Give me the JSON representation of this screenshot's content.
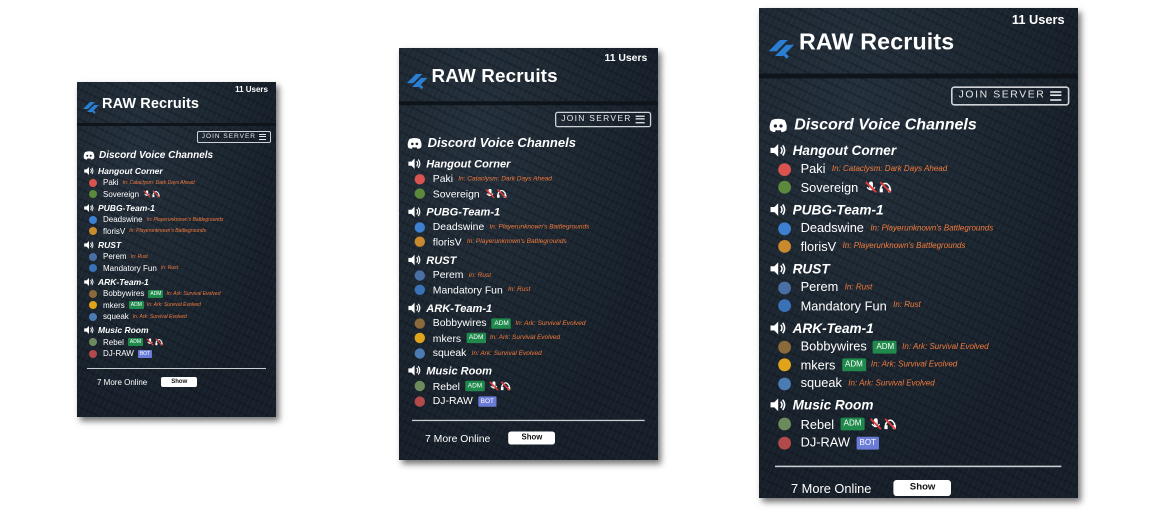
{
  "server": {
    "name": "RAW Recruits",
    "user_count": "11 Users",
    "join_label": "JOIN SERVER",
    "title": "Discord Voice Channels",
    "more_online": "7 More Online",
    "show_label": "Show"
  },
  "colors": {
    "background": "#1b2530",
    "game_text": "#f47b3c",
    "adm_badge": "#1f8a4c",
    "bot_badge": "#6b7cd8",
    "logo": "#2a7fd4"
  },
  "icons": {
    "logo": "raw-logo-icon",
    "join": "hamburger-icon",
    "title": "discord-icon",
    "channel": "speaker-icon",
    "muted": "mic-muted-icon",
    "deafened": "headphones-deafened-icon"
  },
  "channels": [
    {
      "name": "Hangout Corner",
      "members": [
        {
          "name": "Paki",
          "game": "In: Cataclysm: Dark Days Ahead"
        },
        {
          "name": "Sovereign",
          "muted": true,
          "deafened": true
        }
      ]
    },
    {
      "name": "PUBG-Team-1",
      "members": [
        {
          "name": "Deadswine",
          "game": "In: Playerunknown's Battlegrounds"
        },
        {
          "name": "florisV",
          "game": "In: Playerunknown's Battlegrounds"
        }
      ]
    },
    {
      "name": "RUST",
      "members": [
        {
          "name": "Perem",
          "game": "In: Rust"
        },
        {
          "name": "Mandatory Fun",
          "game": "In: Rust"
        }
      ]
    },
    {
      "name": "ARK-Team-1",
      "members": [
        {
          "name": "Bobbywires",
          "badge": "ADM",
          "game": "In: Ark: Survival Evolved"
        },
        {
          "name": "mkers",
          "badge": "ADM",
          "game": "In: Ark: Survival Evolved"
        },
        {
          "name": "squeak",
          "game": "In: Ark: Survival Evolved"
        }
      ]
    },
    {
      "name": "Music Room",
      "members": [
        {
          "name": "Rebel",
          "badge": "ADM",
          "muted": true,
          "deafened": true
        },
        {
          "name": "DJ-RAW",
          "badge": "BOT"
        }
      ]
    }
  ]
}
